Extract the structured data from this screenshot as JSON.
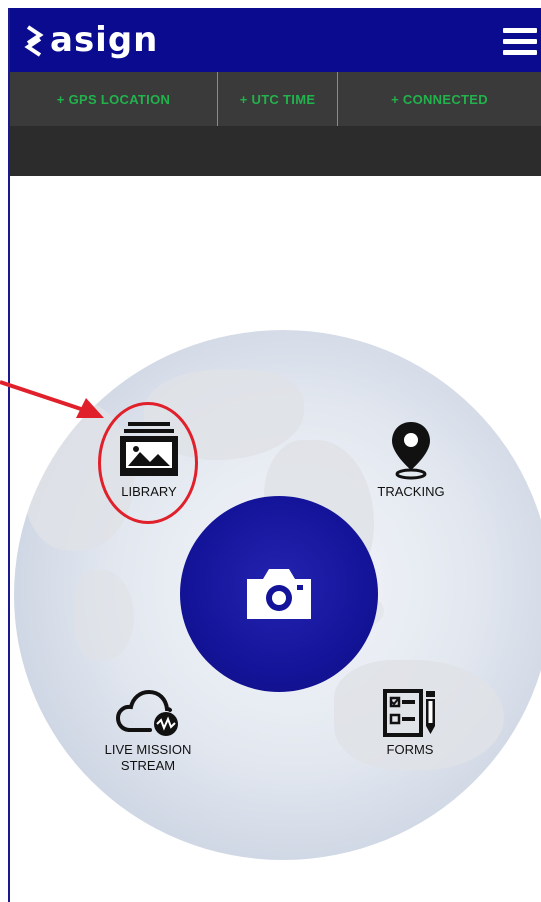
{
  "app": {
    "logo_text": "asign"
  },
  "status_bar": {
    "items": [
      {
        "label": "+ GPS LOCATION"
      },
      {
        "label": "+ UTC TIME"
      },
      {
        "label": "+ CONNECTED"
      }
    ],
    "accent_color": "#22b24c"
  },
  "menu": {
    "library": {
      "label": "LIBRARY",
      "icon": "library-icon"
    },
    "tracking": {
      "label": "TRACKING",
      "icon": "map-pin-icon"
    },
    "live_stream": {
      "label_line1": "LIVE MISSION",
      "label_line2": "STREAM",
      "icon": "cloud-stream-icon"
    },
    "forms": {
      "label": "FORMS",
      "icon": "forms-icon"
    },
    "camera": {
      "icon": "camera-icon"
    }
  },
  "colors": {
    "header_bg": "#0b0b8f",
    "camera_bg": "#14149a",
    "annotation": "#e0202a"
  }
}
